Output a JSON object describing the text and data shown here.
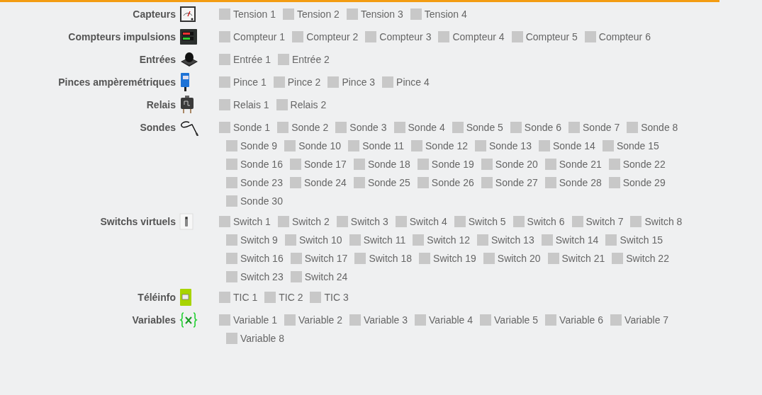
{
  "sections": [
    {
      "label": "Capteurs",
      "items": [
        {
          "label": "Tension 1",
          "checked": false
        },
        {
          "label": "Tension 2",
          "checked": false
        },
        {
          "label": "Tension 3",
          "checked": false
        },
        {
          "label": "Tension 4",
          "checked": false
        }
      ]
    },
    {
      "label": "Compteurs impulsions",
      "items": [
        {
          "label": "Compteur 1",
          "checked": false
        },
        {
          "label": "Compteur 2",
          "checked": false
        },
        {
          "label": "Compteur 3",
          "checked": false
        },
        {
          "label": "Compteur 4",
          "checked": false
        },
        {
          "label": "Compteur 5",
          "checked": false
        },
        {
          "label": "Compteur 6",
          "checked": false
        }
      ]
    },
    {
      "label": "Entrées",
      "items": [
        {
          "label": "Entrée 1",
          "checked": false
        },
        {
          "label": "Entrée 2",
          "checked": false
        }
      ]
    },
    {
      "label": "Pinces ampèremétriques",
      "items": [
        {
          "label": "Pince 1",
          "checked": false
        },
        {
          "label": "Pince 2",
          "checked": false
        },
        {
          "label": "Pince 3",
          "checked": false
        },
        {
          "label": "Pince 4",
          "checked": false
        }
      ]
    },
    {
      "label": "Relais",
      "items": [
        {
          "label": "Relais 1",
          "checked": false
        },
        {
          "label": "Relais 2",
          "checked": false
        }
      ]
    },
    {
      "label": "Sondes",
      "items": [
        {
          "label": "Sonde 1",
          "checked": false
        },
        {
          "label": "Sonde 2",
          "checked": false
        },
        {
          "label": "Sonde 3",
          "checked": false
        },
        {
          "label": "Sonde 4",
          "checked": false
        },
        {
          "label": "Sonde 5",
          "checked": false
        },
        {
          "label": "Sonde 6",
          "checked": false
        },
        {
          "label": "Sonde 7",
          "checked": false
        },
        {
          "label": "Sonde 8",
          "checked": false
        },
        {
          "label": "Sonde 9",
          "checked": false
        },
        {
          "label": "Sonde 10",
          "checked": false
        },
        {
          "label": "Sonde 11",
          "checked": false
        },
        {
          "label": "Sonde 12",
          "checked": false
        },
        {
          "label": "Sonde 13",
          "checked": false
        },
        {
          "label": "Sonde 14",
          "checked": false
        },
        {
          "label": "Sonde 15",
          "checked": false
        },
        {
          "label": "Sonde 16",
          "checked": false
        },
        {
          "label": "Sonde 17",
          "checked": false
        },
        {
          "label": "Sonde 18",
          "checked": false
        },
        {
          "label": "Sonde 19",
          "checked": false
        },
        {
          "label": "Sonde 20",
          "checked": false
        },
        {
          "label": "Sonde 21",
          "checked": false
        },
        {
          "label": "Sonde 22",
          "checked": false
        },
        {
          "label": "Sonde 23",
          "checked": false
        },
        {
          "label": "Sonde 24",
          "checked": false
        },
        {
          "label": "Sonde 25",
          "checked": false
        },
        {
          "label": "Sonde 26",
          "checked": false
        },
        {
          "label": "Sonde 27",
          "checked": false
        },
        {
          "label": "Sonde 28",
          "checked": false
        },
        {
          "label": "Sonde 29",
          "checked": false
        },
        {
          "label": "Sonde 30",
          "checked": false
        }
      ]
    },
    {
      "label": "Switchs virtuels",
      "items": [
        {
          "label": "Switch 1",
          "checked": false
        },
        {
          "label": "Switch 2",
          "checked": false
        },
        {
          "label": "Switch 3",
          "checked": false
        },
        {
          "label": "Switch 4",
          "checked": false
        },
        {
          "label": "Switch 5",
          "checked": false
        },
        {
          "label": "Switch 6",
          "checked": false
        },
        {
          "label": "Switch 7",
          "checked": false
        },
        {
          "label": "Switch 8",
          "checked": false
        },
        {
          "label": "Switch 9",
          "checked": false
        },
        {
          "label": "Switch 10",
          "checked": false
        },
        {
          "label": "Switch 11",
          "checked": false
        },
        {
          "label": "Switch 12",
          "checked": false
        },
        {
          "label": "Switch 13",
          "checked": false
        },
        {
          "label": "Switch 14",
          "checked": false
        },
        {
          "label": "Switch 15",
          "checked": false
        },
        {
          "label": "Switch 16",
          "checked": false
        },
        {
          "label": "Switch 17",
          "checked": false
        },
        {
          "label": "Switch 18",
          "checked": false
        },
        {
          "label": "Switch 19",
          "checked": false
        },
        {
          "label": "Switch 20",
          "checked": false
        },
        {
          "label": "Switch 21",
          "checked": false
        },
        {
          "label": "Switch 22",
          "checked": false
        },
        {
          "label": "Switch 23",
          "checked": false
        },
        {
          "label": "Switch 24",
          "checked": false
        }
      ]
    },
    {
      "label": "Téléinfo",
      "items": [
        {
          "label": "TIC 1",
          "checked": false
        },
        {
          "label": "TIC 2",
          "checked": false
        },
        {
          "label": "TIC 3",
          "checked": false
        }
      ]
    },
    {
      "label": "Variables",
      "items": [
        {
          "label": "Variable 1",
          "checked": false
        },
        {
          "label": "Variable 2",
          "checked": false
        },
        {
          "label": "Variable 3",
          "checked": false
        },
        {
          "label": "Variable 4",
          "checked": false
        },
        {
          "label": "Variable 5",
          "checked": false
        },
        {
          "label": "Variable 6",
          "checked": false
        },
        {
          "label": "Variable 7",
          "checked": false
        },
        {
          "label": "Variable 8",
          "checked": false
        }
      ]
    }
  ]
}
